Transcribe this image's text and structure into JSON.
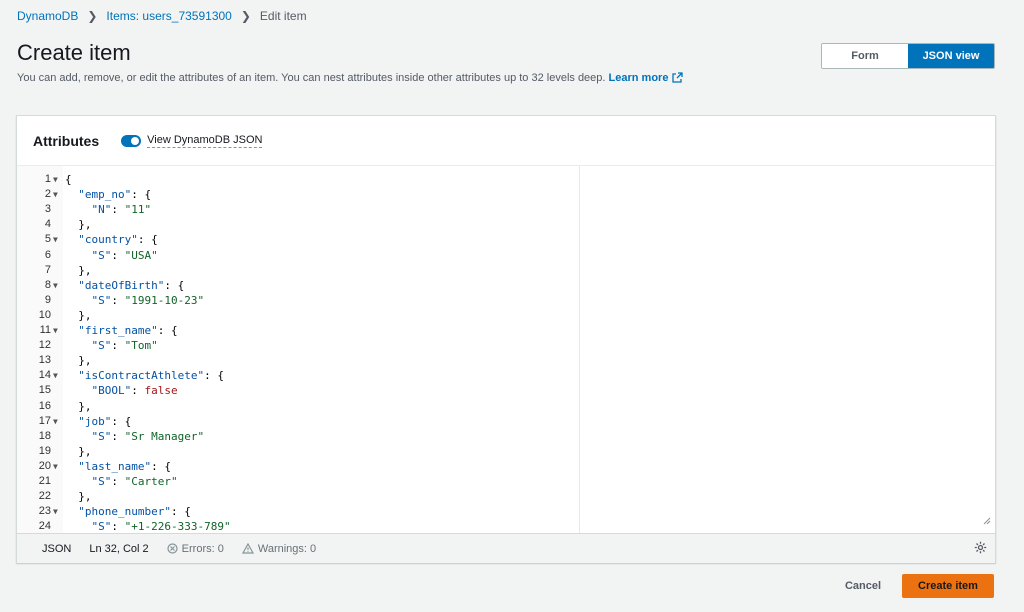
{
  "breadcrumb": {
    "items": [
      {
        "label": "DynamoDB"
      },
      {
        "label": "Items: users_73591300"
      },
      {
        "label": "Edit item"
      }
    ]
  },
  "header": {
    "title": "Create item",
    "description": "You can add, remove, or edit the attributes of an item. You can nest attributes inside other attributes up to 32 levels deep.",
    "learn_more": "Learn more"
  },
  "view_toggle": {
    "form": "Form",
    "json": "JSON view",
    "selected": "JSON view"
  },
  "panel": {
    "title": "Attributes",
    "toggle_label": "View DynamoDB JSON",
    "toggle_on": true
  },
  "editor": {
    "lines": [
      {
        "n": "1",
        "fold": true,
        "tokens": [
          {
            "t": "p",
            "v": "{"
          }
        ]
      },
      {
        "n": "2",
        "fold": true,
        "tokens": [
          {
            "t": "p",
            "v": "  "
          },
          {
            "t": "key",
            "v": "\"emp_no\""
          },
          {
            "t": "p",
            "v": ": {"
          }
        ]
      },
      {
        "n": "3",
        "fold": false,
        "tokens": [
          {
            "t": "p",
            "v": "    "
          },
          {
            "t": "key",
            "v": "\"N\""
          },
          {
            "t": "p",
            "v": ": "
          },
          {
            "t": "str",
            "v": "\"11\""
          }
        ]
      },
      {
        "n": "4",
        "fold": false,
        "tokens": [
          {
            "t": "p",
            "v": "  },"
          }
        ]
      },
      {
        "n": "5",
        "fold": true,
        "tokens": [
          {
            "t": "p",
            "v": "  "
          },
          {
            "t": "key",
            "v": "\"country\""
          },
          {
            "t": "p",
            "v": ": {"
          }
        ]
      },
      {
        "n": "6",
        "fold": false,
        "tokens": [
          {
            "t": "p",
            "v": "    "
          },
          {
            "t": "key",
            "v": "\"S\""
          },
          {
            "t": "p",
            "v": ": "
          },
          {
            "t": "str",
            "v": "\"USA\""
          }
        ]
      },
      {
        "n": "7",
        "fold": false,
        "tokens": [
          {
            "t": "p",
            "v": "  },"
          }
        ]
      },
      {
        "n": "8",
        "fold": true,
        "tokens": [
          {
            "t": "p",
            "v": "  "
          },
          {
            "t": "key",
            "v": "\"dateOfBirth\""
          },
          {
            "t": "p",
            "v": ": {"
          }
        ]
      },
      {
        "n": "9",
        "fold": false,
        "tokens": [
          {
            "t": "p",
            "v": "    "
          },
          {
            "t": "key",
            "v": "\"S\""
          },
          {
            "t": "p",
            "v": ": "
          },
          {
            "t": "str",
            "v": "\"1991-10-23\""
          }
        ]
      },
      {
        "n": "10",
        "fold": false,
        "tokens": [
          {
            "t": "p",
            "v": "  },"
          }
        ]
      },
      {
        "n": "11",
        "fold": true,
        "tokens": [
          {
            "t": "p",
            "v": "  "
          },
          {
            "t": "key",
            "v": "\"first_name\""
          },
          {
            "t": "p",
            "v": ": {"
          }
        ]
      },
      {
        "n": "12",
        "fold": false,
        "tokens": [
          {
            "t": "p",
            "v": "    "
          },
          {
            "t": "key",
            "v": "\"S\""
          },
          {
            "t": "p",
            "v": ": "
          },
          {
            "t": "str",
            "v": "\"Tom\""
          }
        ]
      },
      {
        "n": "13",
        "fold": false,
        "tokens": [
          {
            "t": "p",
            "v": "  },"
          }
        ]
      },
      {
        "n": "14",
        "fold": true,
        "tokens": [
          {
            "t": "p",
            "v": "  "
          },
          {
            "t": "key",
            "v": "\"isContractAthlete\""
          },
          {
            "t": "p",
            "v": ": {"
          }
        ]
      },
      {
        "n": "15",
        "fold": false,
        "tokens": [
          {
            "t": "p",
            "v": "    "
          },
          {
            "t": "key",
            "v": "\"BOOL\""
          },
          {
            "t": "p",
            "v": ": "
          },
          {
            "t": "bool",
            "v": "false"
          }
        ]
      },
      {
        "n": "16",
        "fold": false,
        "tokens": [
          {
            "t": "p",
            "v": "  },"
          }
        ]
      },
      {
        "n": "17",
        "fold": true,
        "tokens": [
          {
            "t": "p",
            "v": "  "
          },
          {
            "t": "key",
            "v": "\"job\""
          },
          {
            "t": "p",
            "v": ": {"
          }
        ]
      },
      {
        "n": "18",
        "fold": false,
        "tokens": [
          {
            "t": "p",
            "v": "    "
          },
          {
            "t": "key",
            "v": "\"S\""
          },
          {
            "t": "p",
            "v": ": "
          },
          {
            "t": "str",
            "v": "\"Sr Manager\""
          }
        ]
      },
      {
        "n": "19",
        "fold": false,
        "tokens": [
          {
            "t": "p",
            "v": "  },"
          }
        ]
      },
      {
        "n": "20",
        "fold": true,
        "tokens": [
          {
            "t": "p",
            "v": "  "
          },
          {
            "t": "key",
            "v": "\"last_name\""
          },
          {
            "t": "p",
            "v": ": {"
          }
        ]
      },
      {
        "n": "21",
        "fold": false,
        "tokens": [
          {
            "t": "p",
            "v": "    "
          },
          {
            "t": "key",
            "v": "\"S\""
          },
          {
            "t": "p",
            "v": ": "
          },
          {
            "t": "str",
            "v": "\"Carter\""
          }
        ]
      },
      {
        "n": "22",
        "fold": false,
        "tokens": [
          {
            "t": "p",
            "v": "  },"
          }
        ]
      },
      {
        "n": "23",
        "fold": true,
        "tokens": [
          {
            "t": "p",
            "v": "  "
          },
          {
            "t": "key",
            "v": "\"phone_number\""
          },
          {
            "t": "p",
            "v": ": {"
          }
        ]
      },
      {
        "n": "24",
        "fold": false,
        "tokens": [
          {
            "t": "p",
            "v": "    "
          },
          {
            "t": "key",
            "v": "\"S\""
          },
          {
            "t": "p",
            "v": ": "
          },
          {
            "t": "str",
            "v": "\"+1-226-333-789\""
          }
        ]
      }
    ]
  },
  "status_bar": {
    "mode": "JSON",
    "position": "Ln 32, Col 2",
    "errors": "Errors: 0",
    "warnings": "Warnings: 0"
  },
  "footer": {
    "cancel": "Cancel",
    "create": "Create item"
  },
  "colors": {
    "accent": "#0073bb",
    "primary_button": "#ec7211",
    "json_key": "#0451a5",
    "json_string": "#116329",
    "json_bool": "#a31515"
  }
}
